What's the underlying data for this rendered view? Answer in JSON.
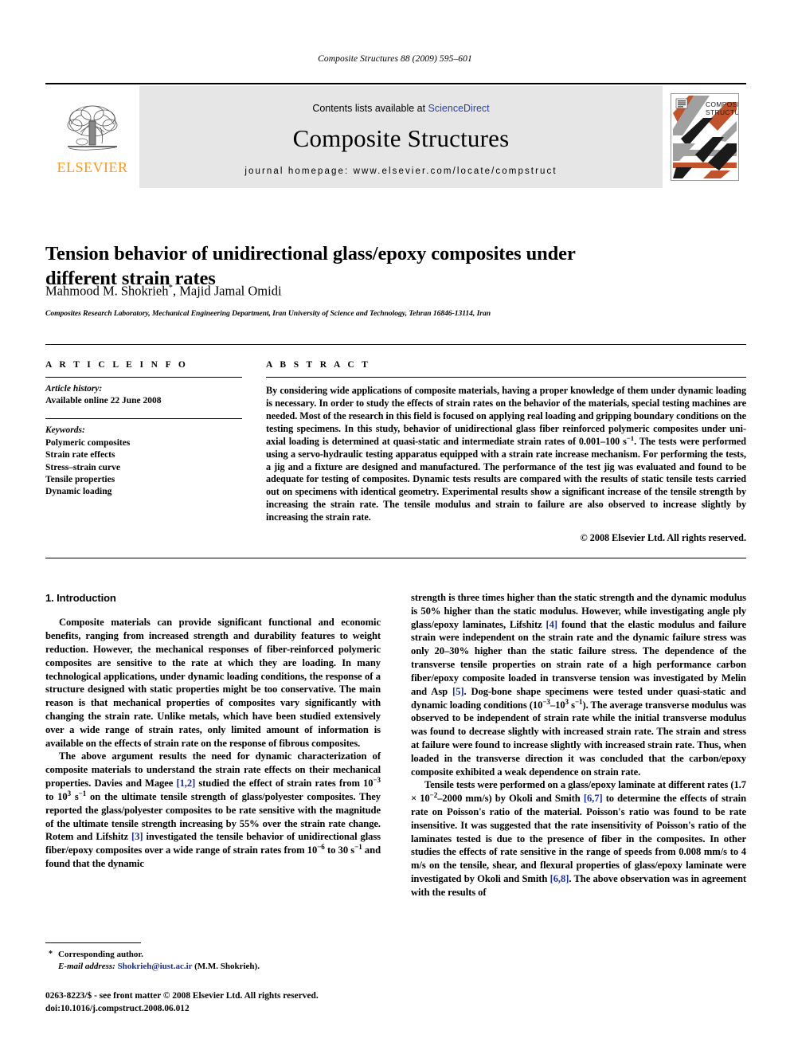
{
  "running_head": "Composite Structures 88 (2009) 595–601",
  "masthead": {
    "publisher_name": "ELSEVIER",
    "contents_prefix": "Contents lists available at ",
    "sciencedirect": "ScienceDirect",
    "journal_name": "Composite Structures",
    "homepage": "journal homepage: www.elsevier.com/locate/compstruct",
    "cover_title_line1": "COMPOSITE",
    "cover_title_line2": "STRUCTURES",
    "accent_orange": "#F59A23",
    "link_blue": "#2b3fa0",
    "cover_orange": "#C0532B",
    "cover_gray": "#A0A0A0",
    "cover_black": "#1a1a1a"
  },
  "article": {
    "title": "Tension behavior of unidirectional glass/epoxy composites under different strain rates",
    "authors": "Mahmood M. Shokrieh",
    "authors_rest": ", Majid Jamal Omidi",
    "corresponding_marker": "*",
    "affiliation": "Composites Research Laboratory, Mechanical Engineering Department, Iran University of Science and Technology, Tehran 16846-13114, Iran"
  },
  "info": {
    "label": "A R T I C L E   I N F O",
    "history_header": "Article history:",
    "history_value": "Available online 22 June 2008",
    "keywords_header": "Keywords:",
    "keywords": [
      "Polymeric composites",
      "Strain rate effects",
      "Stress–strain curve",
      "Tensile properties",
      "Dynamic loading"
    ]
  },
  "abstract": {
    "label": "A B S T R A C T",
    "paragraph_part1": "By considering wide applications of composite materials, having a proper knowledge of them under dynamic loading is necessary. In order to study the effects of strain rates on the behavior of the materials, special testing machines are needed. Most of the research in this field is focused on applying real loading and gripping boundary conditions on the testing specimens. In this study, behavior of unidirectional glass fiber reinforced polymeric composites under uni-axial loading is determined at quasi-static and intermediate strain rates of 0.001–100 s",
    "exp1": "−1",
    "paragraph_part2": ". The tests were performed using a servo-hydraulic testing apparatus equipped with a strain rate increase mechanism. For performing the tests, a jig and a fixture are designed and manufactured. The performance of the test jig was evaluated and found to be adequate for testing of composites. Dynamic tests results are compared with the results of static tensile tests carried out on specimens with identical geometry. Experimental results show a significant increase of the tensile strength by increasing the strain rate. The tensile modulus and strain to failure are also observed to increase slightly by increasing the strain rate.",
    "copyright": "© 2008 Elsevier Ltd. All rights reserved."
  },
  "body": {
    "section_title": "1. Introduction",
    "left": {
      "p1": "Composite materials can provide significant functional and economic benefits, ranging from increased strength and durability features to weight reduction. However, the mechanical responses of fiber-reinforced polymeric composites are sensitive to the rate at which they are loading. In many technological applications, under dynamic loading conditions, the response of a structure designed with static properties might be too conservative. The main reason is that mechanical properties of composites vary significantly with changing the strain rate. Unlike metals, which have been studied extensively over a wide range of strain rates, only limited amount of information is available on the effects of strain rate on the response of fibrous composites.",
      "p2_a": "The above argument results the need for dynamic characterization of composite materials to understand the strain rate effects on their mechanical properties. Davies and Magee ",
      "p2_cite1": "[1,2]",
      "p2_b": " studied the effect of strain rates from 10",
      "p2_exp1": "−3",
      "p2_c": " to 10",
      "p2_exp2": "3",
      "p2_d": " s",
      "p2_exp3": "−1",
      "p2_e": " on the ultimate tensile strength of glass/polyester composites. They reported the glass/polyester composites to be rate sensitive with the magnitude of the ultimate tensile strength increasing by 55% over the strain rate change. Rotem and Lifshitz ",
      "p2_cite2": "[3]",
      "p2_f": " investigated the tensile behavior of unidirectional glass fiber/epoxy composites over a wide range of strain rates from 10",
      "p2_exp4": "−6",
      "p2_g": " to 30 s",
      "p2_exp5": "−1",
      "p2_h": " and found that the dynamic"
    },
    "right": {
      "p1_a": "strength is three times higher than the static strength and the dynamic modulus is 50% higher than the static modulus. However, while investigating angle ply glass/epoxy laminates, Lifshitz ",
      "p1_cite1": "[4]",
      "p1_b": " found that the elastic modulus and failure strain were independent on the strain rate and the dynamic failure stress was only 20–30% higher than the static failure stress. The dependence of the transverse tensile properties on strain rate of a high performance carbon fiber/epoxy composite loaded in transverse tension was investigated by Melin and Asp ",
      "p1_cite2": "[5]",
      "p1_c": ". Dog-bone shape specimens were tested under quasi-static and dynamic loading conditions (10",
      "p1_exp1": "−3",
      "p1_d": "–10",
      "p1_exp2": "3",
      "p1_e": " s",
      "p1_exp3": "−1",
      "p1_f": "). The average transverse modulus was observed to be independent of strain rate while the initial transverse modulus was found to decrease slightly with increased strain rate. The strain and stress at failure were found to increase slightly with increased strain rate. Thus, when loaded in the transverse direction it was concluded that the carbon/epoxy composite exhibited a weak dependence on strain rate.",
      "p2_a": "Tensile tests were performed on a glass/epoxy laminate at different rates (1.7 × 10",
      "p2_exp1": "−2",
      "p2_b": "–2000 mm/s) by Okoli and Smith ",
      "p2_cite1": "[6,7]",
      "p2_c": " to determine the effects of strain rate on Poisson's ratio of the material. Poisson's ratio was found to be rate insensitive. It was suggested that the rate insensitivity of Poisson's ratio of the laminates tested is due to the presence of fiber in the composites. In other studies the effects of rate sensitive in the range of speeds from 0.008 mm/s to 4 m/s on the tensile, shear, and flexural properties of glass/epoxy laminate were investigated by Okoli and Smith ",
      "p2_cite2": "[6,8]",
      "p2_d": ". The above observation was in agreement with the results of"
    }
  },
  "footnotes": {
    "corresponding_bullet": "*",
    "corresponding_text": "Corresponding author.",
    "email_label": "E-mail address:",
    "email": "Shokrieh@iust.ac.ir",
    "email_suffix": " (M.M. Shokrieh)."
  },
  "imprint": {
    "line1": "0263-8223/$ - see front matter © 2008 Elsevier Ltd. All rights reserved.",
    "line2": "doi:10.1016/j.compstruct.2008.06.012"
  }
}
